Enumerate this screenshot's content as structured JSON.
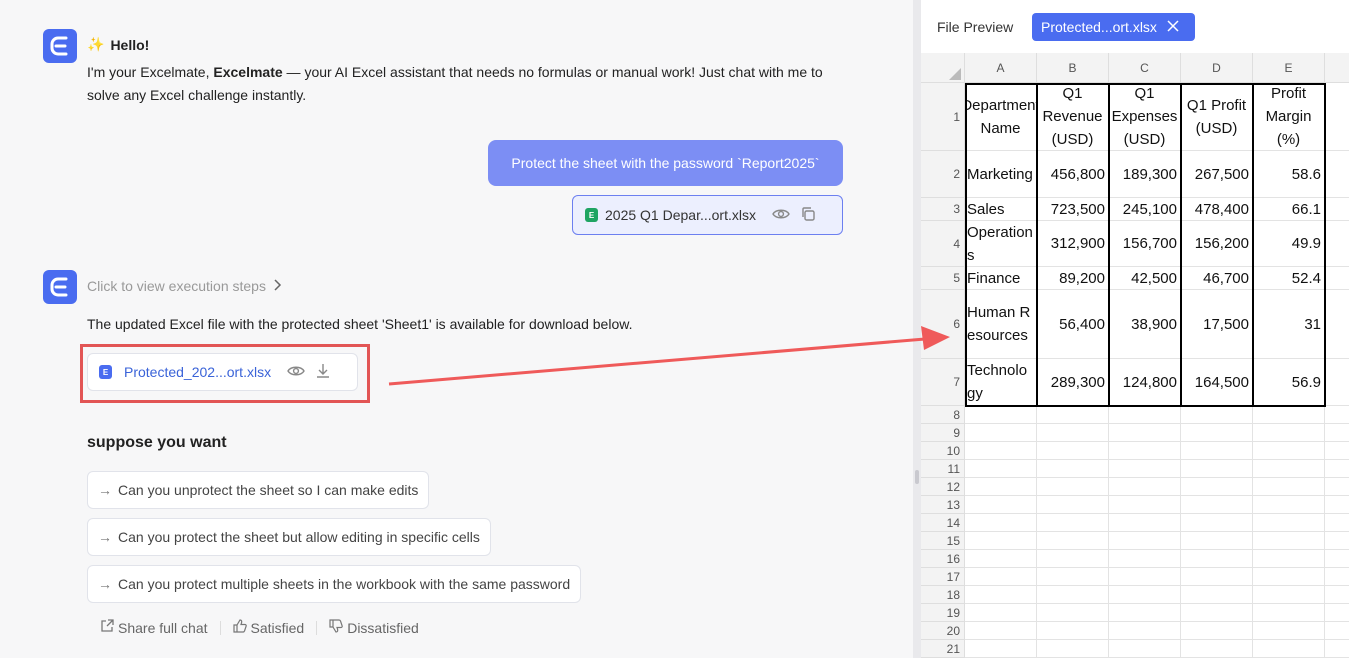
{
  "chat": {
    "hello_title": "Hello!",
    "hello_intro": "I'm your Excelmate, ",
    "hello_brand": "Excelmate",
    "hello_rest": " — your AI Excel assistant that needs no formulas or manual work! Just chat with me to solve any Excel challenge instantly.",
    "user_message": "Protect the sheet with the password `Report2025`",
    "user_file_name": "2025 Q1 Depar...ort.xlsx",
    "exec_steps": "Click to view execution steps",
    "reply_text": "The updated Excel file with the protected sheet 'Sheet1' is available for download below.",
    "result_file_name": "Protected_202...ort.xlsx",
    "suggest_title": "suppose you want",
    "suggestions": [
      "Can you unprotect the sheet so I can make edits",
      "Can you protect the sheet but allow editing in specific cells",
      "Can you protect multiple sheets in the workbook with the same password"
    ],
    "feedback": {
      "share": "Share full chat",
      "satisfied": "Satisfied",
      "dissatisfied": "Dissatisfied"
    }
  },
  "preview": {
    "label": "File Preview",
    "tab_name": "Protected...ort.xlsx",
    "columns": [
      "A",
      "B",
      "C",
      "D",
      "E"
    ],
    "rows": [
      "1",
      "2",
      "3",
      "4",
      "5",
      "6",
      "7",
      "8",
      "9",
      "10",
      "11",
      "12",
      "13",
      "14",
      "15",
      "16",
      "17",
      "18",
      "19",
      "20",
      "21"
    ],
    "headers": [
      "Department Name",
      "Q1 Revenue (USD)",
      "Q1 Expenses (USD)",
      "Q1 Profit (USD)",
      "Profit Margin (%)"
    ],
    "data": [
      [
        "Marketing",
        "456,800",
        "189,300",
        "267,500",
        "58.6"
      ],
      [
        "Sales",
        "723,500",
        "245,100",
        "478,400",
        "66.1"
      ],
      [
        "Operations",
        "312,900",
        "156,700",
        "156,200",
        "49.9"
      ],
      [
        "Finance",
        "89,200",
        "42,500",
        "46,700",
        "52.4"
      ],
      [
        "Human Resources",
        "56,400",
        "38,900",
        "17,500",
        "31"
      ],
      [
        "Technology",
        "289,300",
        "124,800",
        "164,500",
        "56.9"
      ]
    ]
  },
  "colors": {
    "accent": "#4a6cf0",
    "user_bubble": "#7c8ef4",
    "highlight": "#e25555",
    "excel_green": "#1fa463"
  }
}
